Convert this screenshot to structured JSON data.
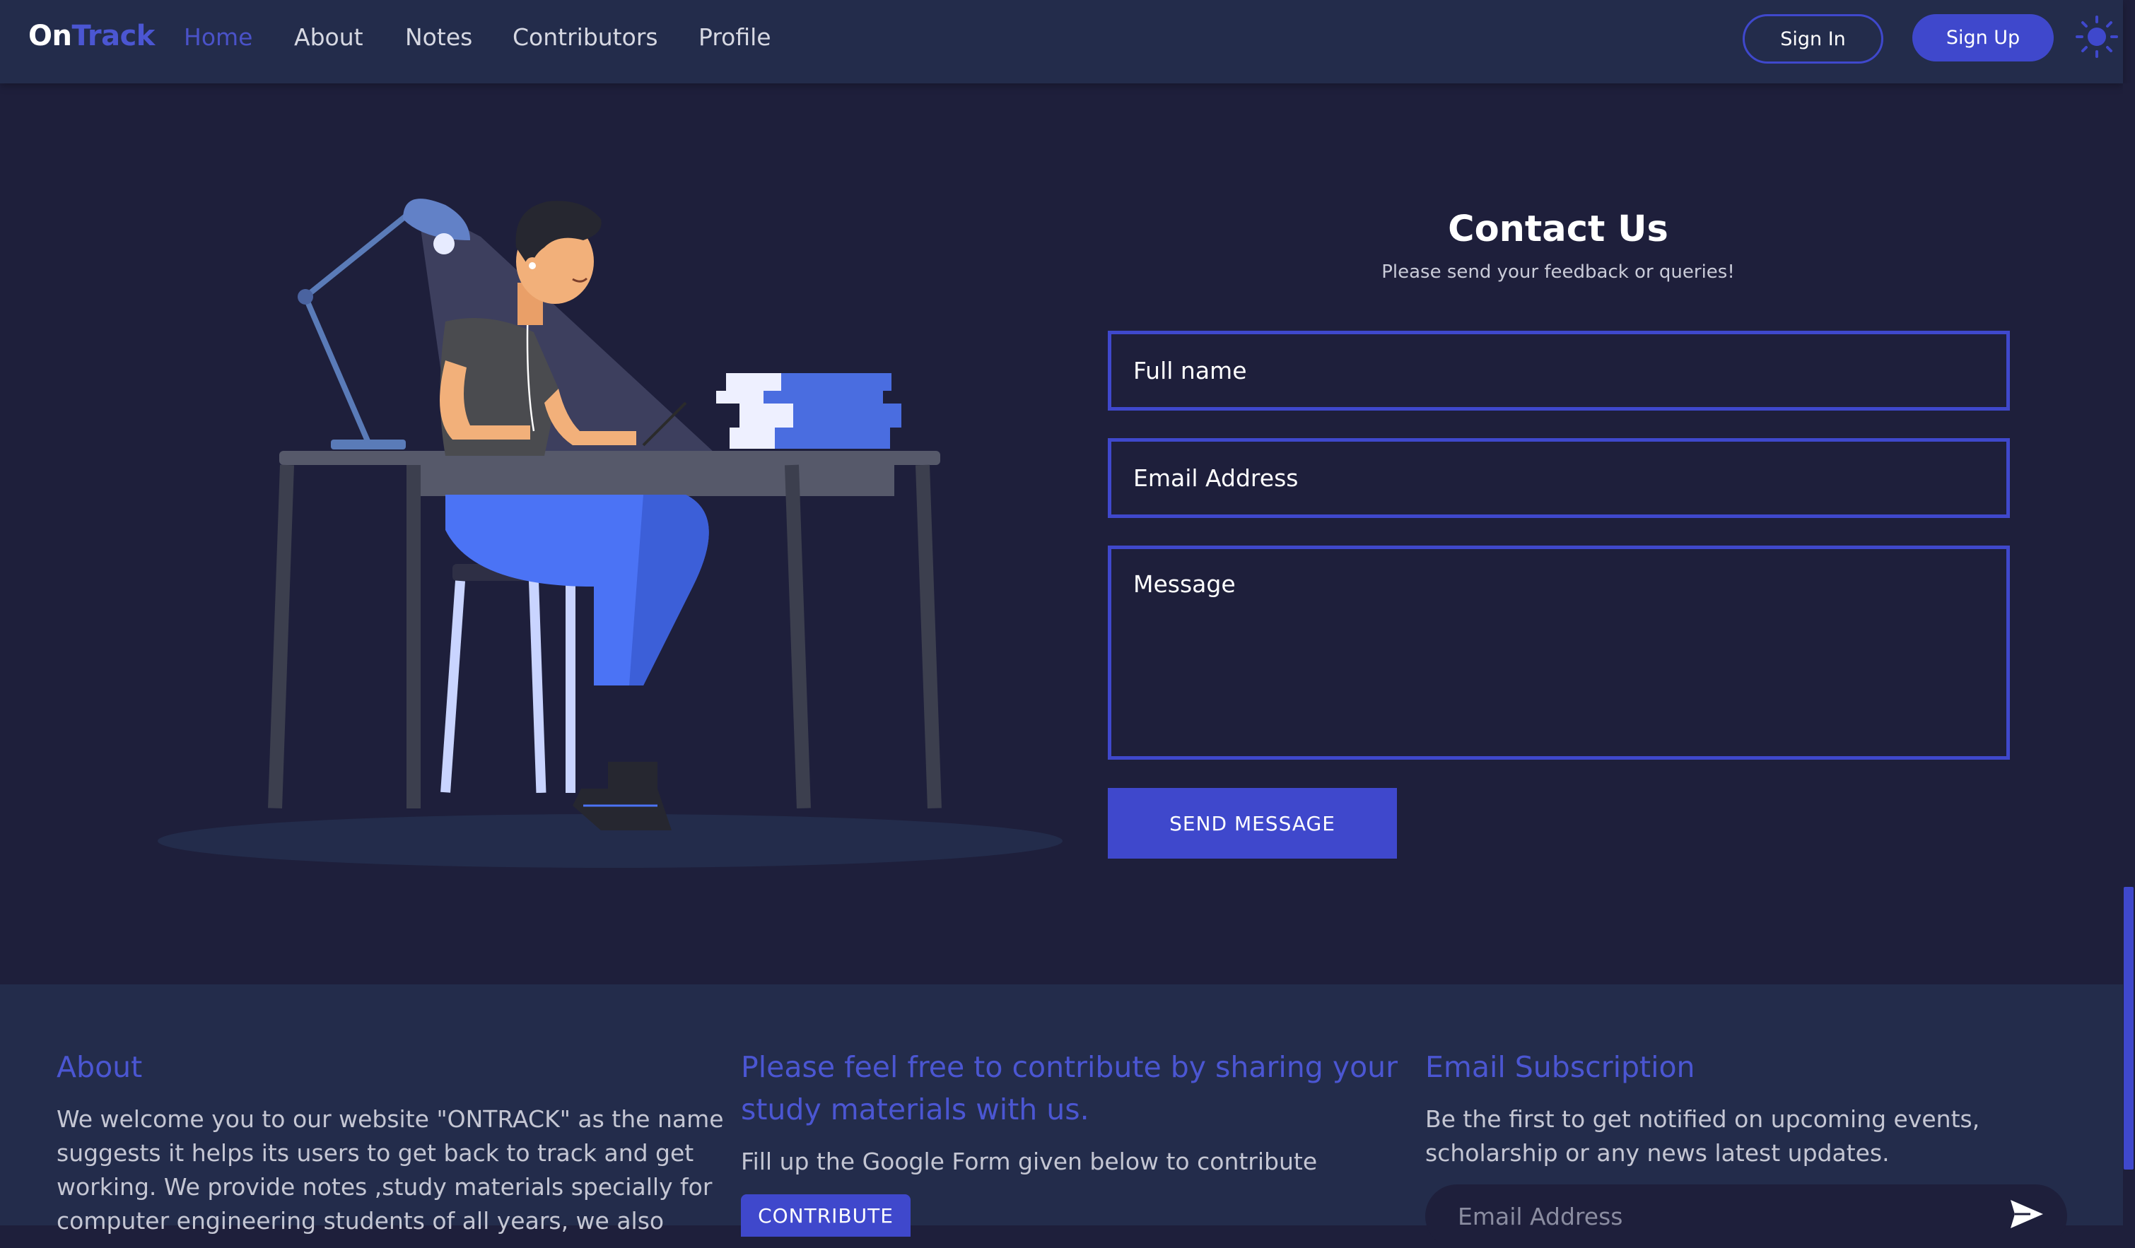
{
  "brand": {
    "part1": "On",
    "part2": "Track"
  },
  "nav": {
    "home": "Home",
    "about": "About",
    "notes": "Notes",
    "contributors": "Contributors",
    "profile": "Profile"
  },
  "auth": {
    "sign_in": "Sign In",
    "sign_up": "Sign Up"
  },
  "contact": {
    "title": "Contact Us",
    "subtitle": "Please send your feedback or queries!",
    "name_placeholder": "Full name",
    "email_placeholder": "Email Address",
    "message_placeholder": "Message",
    "send_label": "SEND MESSAGE"
  },
  "footer": {
    "about": {
      "heading": "About",
      "text_lines": [
        "We welcome you to our website \"ONTRACK\" as the name",
        "suggests it helps its users to get back to track and get",
        "working. We provide notes ,study materials specially for",
        "computer engineering students of all years, we also"
      ]
    },
    "contribute": {
      "heading_lines": [
        "Please feel free to contribute by sharing your",
        "study materials with us."
      ],
      "text": "Fill up the Google Form given below to contribute",
      "button": "CONTRIBUTE"
    },
    "subscription": {
      "heading": "Email Subscription",
      "text_lines": [
        "Be the first to get notified on upcoming events,",
        "scholarship or any news latest updates."
      ],
      "placeholder": "Email Address"
    }
  },
  "colors": {
    "page_bg": "#1e1f3b",
    "nav_bg": "#232c4b",
    "accent": "#3f48cc",
    "accent_text": "#4b56d2"
  },
  "icons": {
    "theme_toggle": "sun-icon",
    "subscribe_send": "paper-plane-icon"
  }
}
